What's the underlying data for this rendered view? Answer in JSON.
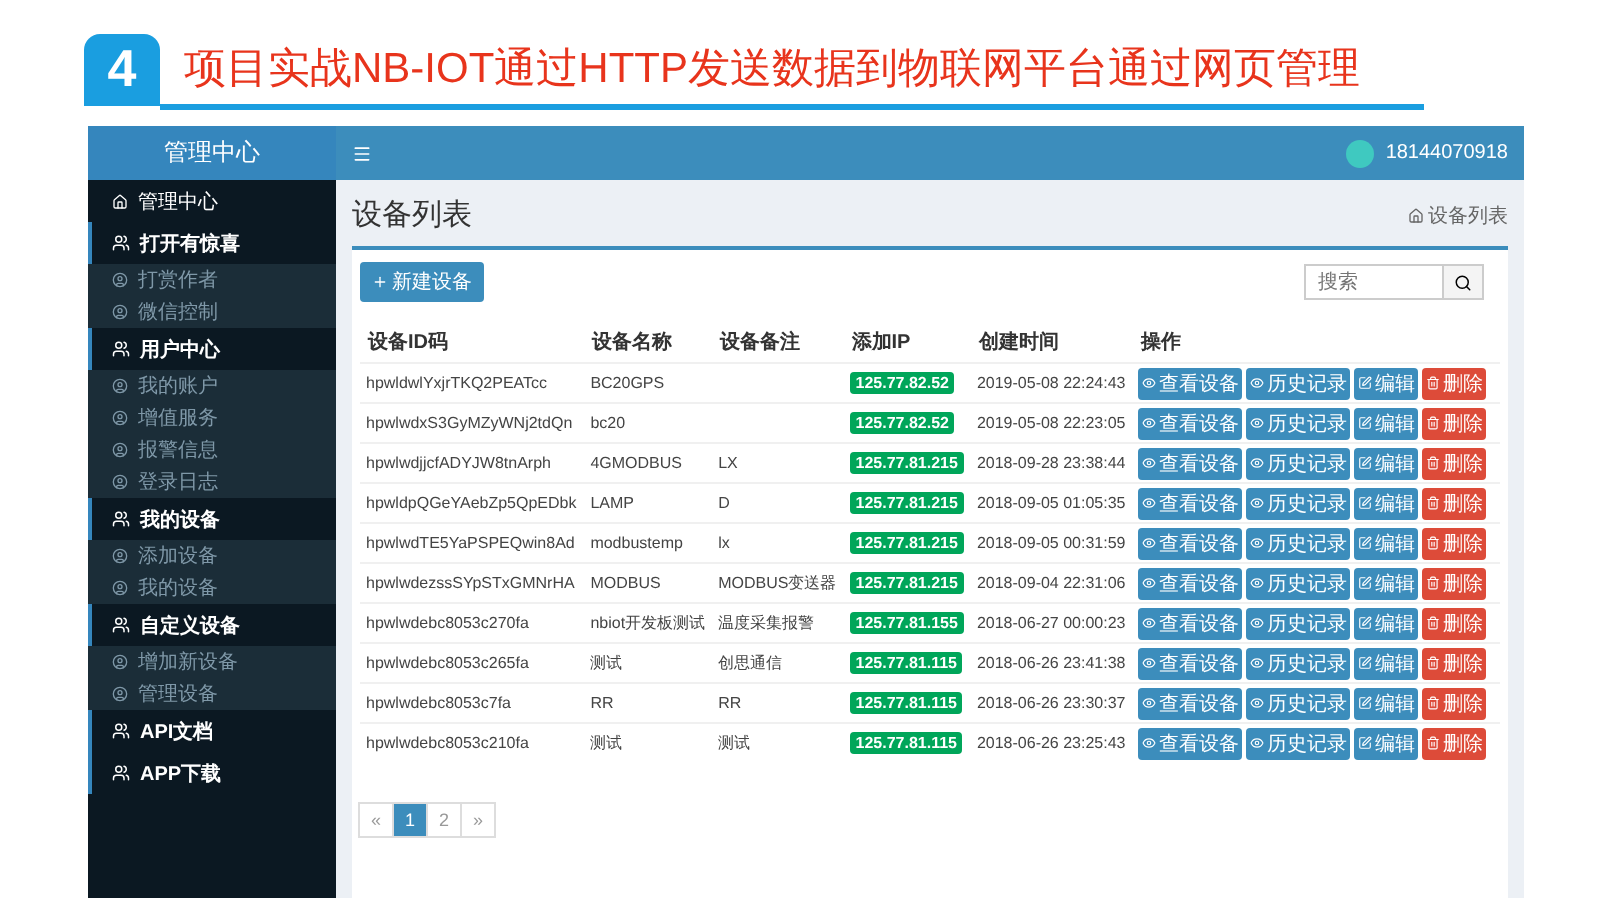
{
  "banner": {
    "number": "4",
    "title": "项目实战NB-IOT通过HTTP发送数据到物联网平台通过网页管理"
  },
  "sidebar": {
    "title": "管理中心",
    "items": [
      {
        "kind": "home",
        "label": "管理中心"
      },
      {
        "kind": "section",
        "label": "打开有惊喜",
        "children": [
          {
            "kind": "sub",
            "label": "打赏作者"
          },
          {
            "kind": "sub",
            "label": "微信控制"
          }
        ]
      },
      {
        "kind": "section",
        "label": "用户中心",
        "children": [
          {
            "kind": "sub",
            "label": "我的账户"
          },
          {
            "kind": "sub",
            "label": "增值服务"
          },
          {
            "kind": "sub",
            "label": "报警信息"
          },
          {
            "kind": "sub",
            "label": "登录日志"
          }
        ]
      },
      {
        "kind": "section",
        "label": "我的设备",
        "children": [
          {
            "kind": "sub",
            "label": "添加设备"
          },
          {
            "kind": "sub",
            "label": "我的设备"
          }
        ]
      },
      {
        "kind": "section",
        "label": "自定义设备",
        "children": [
          {
            "kind": "sub",
            "label": "增加新设备"
          },
          {
            "kind": "sub",
            "label": "管理设备"
          }
        ]
      },
      {
        "kind": "section",
        "label": "API文档"
      },
      {
        "kind": "section",
        "label": "APP下载"
      }
    ]
  },
  "topbar": {
    "user": "18144070918"
  },
  "page": {
    "title": "设备列表",
    "breadcrumb": "设备列表",
    "new_button": "新建设备",
    "search": {
      "placeholder": "搜索"
    }
  },
  "table": {
    "columns": [
      "设备ID码",
      "设备名称",
      "设备备注",
      "添加IP",
      "创建时间",
      "操作"
    ],
    "rows": [
      {
        "id": "hpwldwlYxjrTKQ2PEATcc",
        "name": "BC20GPS",
        "note": "",
        "ip": "125.77.82.52",
        "time": "2019-05-08 22:24:43",
        "actions": [
          {
            "kind": "view",
            "label": "查看设备"
          },
          {
            "kind": "history",
            "label": "历史记录"
          },
          {
            "kind": "edit",
            "label": "编辑"
          },
          {
            "kind": "delete",
            "label": "删除"
          }
        ]
      },
      {
        "id": "hpwlwdxS3GyMZyWNj2tdQn",
        "name": "bc20",
        "note": "",
        "ip": "125.77.82.52",
        "time": "2019-05-08 22:23:05",
        "actions": [
          {
            "kind": "view",
            "label": "查看设备"
          },
          {
            "kind": "history",
            "label": "历史记录"
          },
          {
            "kind": "edit",
            "label": "编辑"
          },
          {
            "kind": "delete",
            "label": "删除"
          }
        ]
      },
      {
        "id": "hpwlwdjjcfADYJW8tnArph",
        "name": "4GMODBUS",
        "note": "LX",
        "ip": "125.77.81.215",
        "time": "2018-09-28 23:38:44",
        "actions": [
          {
            "kind": "view",
            "label": "查看设备"
          },
          {
            "kind": "history",
            "label": "历史记录"
          },
          {
            "kind": "edit",
            "label": "编辑"
          },
          {
            "kind": "delete",
            "label": "删除"
          }
        ]
      },
      {
        "id": "hpwldpQGeYAebZp5QpEDbk",
        "name": "LAMP",
        "note": "D",
        "ip": "125.77.81.215",
        "time": "2018-09-05 01:05:35",
        "actions": [
          {
            "kind": "view",
            "label": "查看设备"
          },
          {
            "kind": "history",
            "label": "历史记录"
          },
          {
            "kind": "edit",
            "label": "编辑"
          },
          {
            "kind": "delete",
            "label": "删除"
          }
        ]
      },
      {
        "id": "hpwlwdTE5YaPSPEQwin8Ad",
        "name": "modbustemp",
        "note": "lx",
        "ip": "125.77.81.215",
        "time": "2018-09-05 00:31:59",
        "actions": [
          {
            "kind": "view",
            "label": "查看设备"
          },
          {
            "kind": "history",
            "label": "历史记录"
          },
          {
            "kind": "edit",
            "label": "编辑"
          },
          {
            "kind": "delete",
            "label": "删除"
          }
        ]
      },
      {
        "id": "hpwlwdezssSYpSTxGMNrHA",
        "name": "MODBUS",
        "note": "MODBUS变送器",
        "ip": "125.77.81.215",
        "time": "2018-09-04 22:31:06",
        "actions": [
          {
            "kind": "view",
            "label": "查看设备"
          },
          {
            "kind": "history",
            "label": "历史记录"
          },
          {
            "kind": "edit",
            "label": "编辑"
          },
          {
            "kind": "delete",
            "label": "删除"
          }
        ]
      },
      {
        "id": "hpwlwdebc8053c270fa",
        "name": "nbiot开发板测试",
        "note": "温度采集报警",
        "ip": "125.77.81.155",
        "time": "2018-06-27 00:00:23",
        "actions": [
          {
            "kind": "view",
            "label": "查看设备"
          },
          {
            "kind": "history",
            "label": "历史记录"
          },
          {
            "kind": "edit",
            "label": "编辑"
          },
          {
            "kind": "delete",
            "label": "删除"
          }
        ]
      },
      {
        "id": "hpwlwdebc8053c265fa",
        "name": "测试",
        "note": "创思通信",
        "ip": "125.77.81.115",
        "time": "2018-06-26 23:41:38",
        "actions": [
          {
            "kind": "view",
            "label": "查看设备"
          },
          {
            "kind": "history",
            "label": "历史记录"
          },
          {
            "kind": "edit",
            "label": "编辑"
          },
          {
            "kind": "delete",
            "label": "删除"
          }
        ]
      },
      {
        "id": "hpwlwdebc8053c7fa",
        "name": "RR",
        "note": "RR",
        "ip": "125.77.81.115",
        "time": "2018-06-26 23:30:37",
        "actions": [
          {
            "kind": "view",
            "label": "查看设备"
          },
          {
            "kind": "history",
            "label": "历史记录"
          },
          {
            "kind": "edit",
            "label": "编辑"
          },
          {
            "kind": "delete",
            "label": "删除"
          }
        ]
      },
      {
        "id": "hpwlwdebc8053c210fa",
        "name": "测试",
        "note": "测试",
        "ip": "125.77.81.115",
        "time": "2018-06-26 23:25:43",
        "actions": [
          {
            "kind": "view",
            "label": "查看设备"
          },
          {
            "kind": "history",
            "label": "历史记录"
          },
          {
            "kind": "edit",
            "label": "编辑"
          },
          {
            "kind": "delete",
            "label": "删除"
          }
        ]
      }
    ]
  },
  "pagination": [
    {
      "label": "«",
      "selected": false
    },
    {
      "label": "1",
      "selected": true
    },
    {
      "label": "2",
      "selected": false
    },
    {
      "label": "»",
      "selected": false
    }
  ]
}
